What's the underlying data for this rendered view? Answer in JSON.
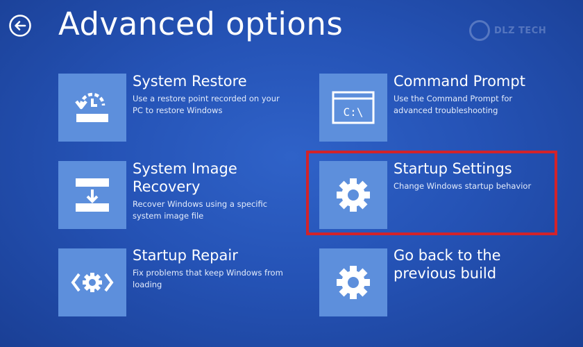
{
  "header": {
    "title": "Advanced options",
    "back_icon": "back-arrow-icon"
  },
  "watermark": {
    "text": "DLZ TECH"
  },
  "options": [
    {
      "id": "system-restore",
      "title": "System Restore",
      "description_lines": [
        "Use a restore point recorded on your",
        "PC to restore Windows"
      ],
      "icon": "system-restore-icon"
    },
    {
      "id": "command-prompt",
      "title": "Command Prompt",
      "description_lines": [
        "Use the Command Prompt for",
        "advanced troubleshooting"
      ],
      "icon": "command-prompt-icon",
      "icon_text": "C:\\"
    },
    {
      "id": "system-image-recovery",
      "title_lines": [
        "System Image",
        "Recovery"
      ],
      "description_lines": [
        "Recover Windows using a specific",
        "system image file"
      ],
      "icon": "system-image-recovery-icon"
    },
    {
      "id": "startup-settings",
      "title": "Startup Settings",
      "description_lines": [
        "Change Windows startup behavior"
      ],
      "icon": "gear-icon",
      "highlighted": true
    },
    {
      "id": "startup-repair",
      "title": "Startup Repair",
      "description_lines": [
        "Fix problems that keep Windows from",
        "loading"
      ],
      "icon": "startup-repair-icon"
    },
    {
      "id": "go-back-previous-build",
      "title_lines": [
        "Go back to the",
        "previous build"
      ],
      "description_lines": [],
      "icon": "gear-icon"
    }
  ],
  "colors": {
    "background": "#2553b6",
    "tile": "#5d8fdc",
    "highlight": "#d2232a",
    "text": "#ffffff"
  }
}
